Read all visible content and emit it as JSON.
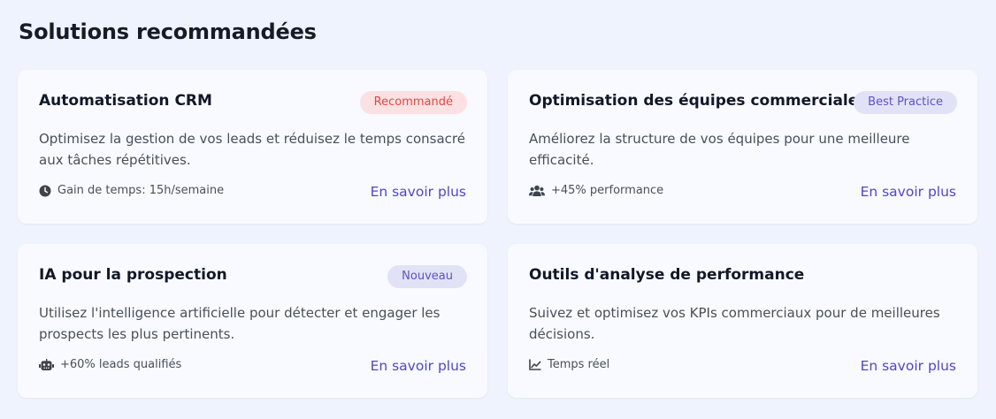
{
  "section": {
    "title": "Solutions recommandées"
  },
  "cards": [
    {
      "title": "Automatisation CRM",
      "badge": "Recommandé",
      "description": "Optimisez la gestion de vos leads et réduisez le temps consacré aux tâches répétitives.",
      "meta_icon": "clock-icon",
      "meta": "Gain de temps: 15h/semaine",
      "link": "En savoir plus"
    },
    {
      "title": "Optimisation des équipes commerciales",
      "badge": "Best Practice",
      "description": "Améliorez la structure de vos équipes pour une meilleure efficacité.",
      "meta_icon": "users-icon",
      "meta": "+45% performance",
      "link": "En savoir plus"
    },
    {
      "title": "IA pour la prospection",
      "badge": "Nouveau",
      "description": "Utilisez l'intelligence artificielle pour détecter et engager les prospects les plus pertinents.",
      "meta_icon": "robot-icon",
      "meta": "+60% leads qualifiés",
      "link": "En savoir plus"
    },
    {
      "title": "Outils d'analyse de performance",
      "badge": "",
      "description": "Suivez et optimisez vos KPIs commerciaux pour de meilleures décisions.",
      "meta_icon": "chart-line-icon",
      "meta": "Temps réel",
      "link": "En savoir plus"
    }
  ],
  "colors": {
    "background": "#eef3fd",
    "card": "#f8faff",
    "link": "#5046c9",
    "badge_red_bg": "#fbe1e1",
    "badge_red_text": "#dc4a4a",
    "badge_purple_bg": "#e2e2f6",
    "badge_purple_text": "#5a53c8"
  }
}
